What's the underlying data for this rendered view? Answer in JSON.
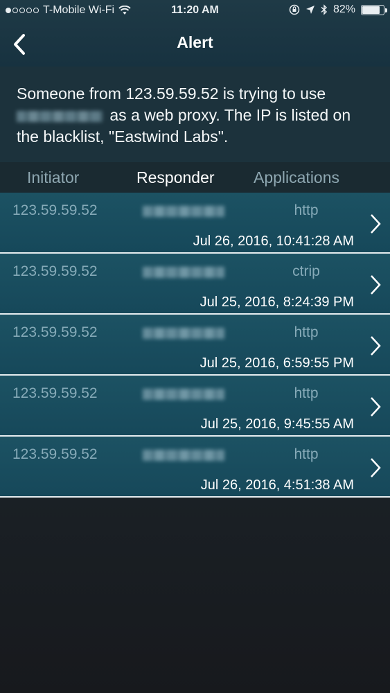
{
  "status_bar": {
    "carrier": "T-Mobile Wi-Fi",
    "time": "11:20 AM",
    "battery": "82%",
    "battery_level": 0.82
  },
  "nav": {
    "title": "Alert"
  },
  "alert": {
    "message_part1": "Someone from 123.59.59.52 is trying to use",
    "message_part2": "as a web proxy. The IP is listed on the blacklist, \"Eastwind Labs\"."
  },
  "columns": {
    "initiator": "Initiator",
    "responder": "Responder",
    "applications": "Applications"
  },
  "rows": [
    {
      "initiator": "123.59.59.52",
      "application": "http",
      "date": "Jul 26, 2016, 10:41:28 AM"
    },
    {
      "initiator": "123.59.59.52",
      "application": "ctrip",
      "date": "Jul 25, 2016, 8:24:39 PM"
    },
    {
      "initiator": "123.59.59.52",
      "application": "http",
      "date": "Jul 25, 2016, 6:59:55 PM"
    },
    {
      "initiator": "123.59.59.52",
      "application": "http",
      "date": "Jul 25, 2016, 9:45:55 AM"
    },
    {
      "initiator": "123.59.59.52",
      "application": "http",
      "date": "Jul 26, 2016, 4:51:38 AM"
    }
  ],
  "colors": {
    "row_bg": "#1c5263",
    "accent_text": "#86aab8"
  }
}
